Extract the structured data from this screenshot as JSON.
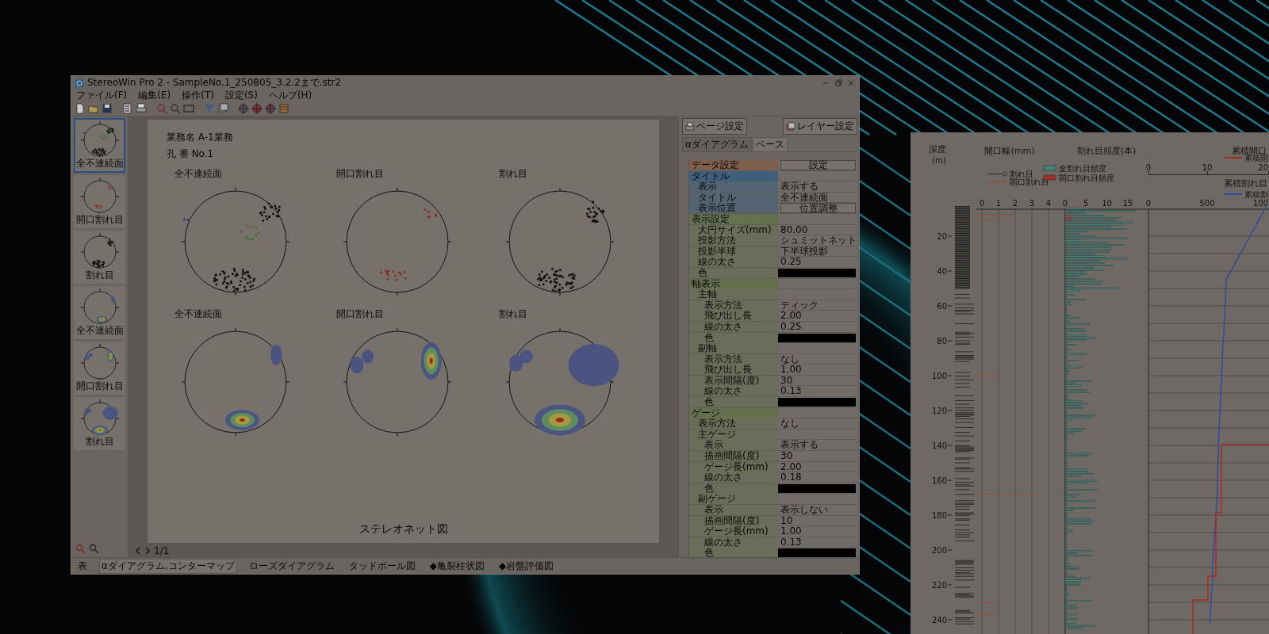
{
  "main_window": {
    "title": "StereoWin Pro 2 - SampleNo.1_250805_3.2.2まで.str2",
    "menu": [
      "ファイル(F)",
      "編集(E)",
      "操作(T)",
      "設定(S)",
      "ヘルプ(H)"
    ],
    "thumbnails": [
      {
        "label": "全不連続面",
        "kind": "points",
        "selected": true
      },
      {
        "label": "開口割れ目",
        "kind": "points",
        "selected": false
      },
      {
        "label": "割れ目",
        "kind": "points",
        "selected": false
      },
      {
        "label": "全不連続面",
        "kind": "contour",
        "selected": false
      },
      {
        "label": "開口割れ目",
        "kind": "contour",
        "selected": false
      },
      {
        "label": "割れ目",
        "kind": "contour",
        "selected": false
      }
    ],
    "document": {
      "project": "業務名 A-1業務",
      "hole": "孔 番 No.1",
      "caption": "ステレオネット図",
      "nets": [
        {
          "title": "全不連続面",
          "kind": "points"
        },
        {
          "title": "開口割れ目",
          "kind": "points"
        },
        {
          "title": "割れ目",
          "kind": "points"
        },
        {
          "title": "全不連続面",
          "kind": "contour"
        },
        {
          "title": "開口割れ目",
          "kind": "contour"
        },
        {
          "title": "割れ目",
          "kind": "contour"
        }
      ]
    },
    "page_indicator": "1/1",
    "panel": {
      "buttons": [
        "ページ設定",
        "レイヤー設定"
      ],
      "tabs": [
        {
          "label": "αダイアグラム",
          "selected": false
        },
        {
          "label": "ベース",
          "selected": true
        }
      ],
      "properties": [
        {
          "label": "データ設定",
          "kind": "button",
          "value": "設定",
          "color": "#7e5f4e"
        },
        {
          "label": "タイトル",
          "kind": "category",
          "color": "#3f5f7c",
          "children": [
            {
              "label": "表示",
              "kind": "text",
              "value": "表示する"
            },
            {
              "label": "タイトル",
              "kind": "text",
              "value": "全不連続面"
            },
            {
              "label": "表示位置",
              "kind": "button",
              "value": "位置調整"
            }
          ]
        },
        {
          "label": "表示設定",
          "kind": "category",
          "color": "#66704f",
          "children": [
            {
              "label": "大円サイズ(mm)",
              "kind": "text",
              "value": "80.00"
            },
            {
              "label": "投影方法",
              "kind": "text",
              "value": "シュミットネット"
            },
            {
              "label": "投影半球",
              "kind": "text",
              "value": "下半球投影"
            },
            {
              "label": "線の太さ",
              "kind": "text",
              "value": "0.25"
            },
            {
              "label": "色",
              "kind": "swatch",
              "color": "#000000"
            }
          ]
        },
        {
          "label": "軸表示",
          "kind": "category",
          "color": "#66704f",
          "children": [
            {
              "label": "主軸",
              "kind": "category",
              "children": [
                {
                  "label": "表示方法",
                  "kind": "text",
                  "value": "ティック"
                },
                {
                  "label": "飛び出し長",
                  "kind": "text",
                  "value": "2.00"
                },
                {
                  "label": "線の太さ",
                  "kind": "text",
                  "value": "0.25"
                },
                {
                  "label": "色",
                  "kind": "swatch",
                  "color": "#000000"
                }
              ]
            },
            {
              "label": "副軸",
              "kind": "category",
              "children": [
                {
                  "label": "表示方法",
                  "kind": "text",
                  "value": "なし"
                },
                {
                  "label": "飛び出し長",
                  "kind": "text",
                  "value": "1.00"
                },
                {
                  "label": "表示間隔(度)",
                  "kind": "text",
                  "value": "30"
                },
                {
                  "label": "線の太さ",
                  "kind": "text",
                  "value": "0.13"
                },
                {
                  "label": "色",
                  "kind": "swatch",
                  "color": "#000000"
                }
              ]
            }
          ]
        },
        {
          "label": "ゲージ",
          "kind": "category",
          "color": "#66704f",
          "children": [
            {
              "label": "表示方法",
              "kind": "text",
              "value": "なし"
            },
            {
              "label": "主ゲージ",
              "kind": "category",
              "children": [
                {
                  "label": "表示",
                  "kind": "text",
                  "value": "表示する"
                },
                {
                  "label": "描画間隔(度)",
                  "kind": "text",
                  "value": "30"
                },
                {
                  "label": "ゲージ長(mm)",
                  "kind": "text",
                  "value": "2.00"
                },
                {
                  "label": "線の太さ",
                  "kind": "text",
                  "value": "0.18"
                },
                {
                  "label": "色",
                  "kind": "swatch",
                  "color": "#000000"
                }
              ]
            },
            {
              "label": "副ゲージ",
              "kind": "category",
              "children": [
                {
                  "label": "表示",
                  "kind": "text",
                  "value": "表示しない"
                },
                {
                  "label": "描画間隔(度)",
                  "kind": "text",
                  "value": "10"
                },
                {
                  "label": "ゲージ長(mm)",
                  "kind": "text",
                  "value": "1.00"
                },
                {
                  "label": "線の太さ",
                  "kind": "text",
                  "value": "0.13"
                },
                {
                  "label": "色",
                  "kind": "swatch",
                  "color": "#000000"
                }
              ]
            }
          ]
        }
      ]
    },
    "bottom_tabs": [
      {
        "label": "表",
        "selected": false
      },
      {
        "label": "αダイアグラム,コンターマップ",
        "selected": true
      },
      {
        "label": "ローズダイアグラム",
        "selected": false
      },
      {
        "label": "タッドポール図",
        "selected": false
      },
      {
        "label": "◆亀裂柱状図",
        "selected": false
      },
      {
        "label": "◆岩盤評価図",
        "selected": false
      }
    ]
  },
  "depth_chart": {
    "depth_header": "深度",
    "depth_unit": "(m)",
    "aperture_header": "開口幅(mm)",
    "frequency_header": "割れ目頻度(本)",
    "cumulative_header": "累積開口",
    "cumulative_count_header": "累積割れ目",
    "aperture_legend": [
      {
        "label": "割れ目",
        "color": "#2e2e2e"
      },
      {
        "label": "開口割れ目",
        "color": "#9a4a3e"
      }
    ],
    "frequency_legend": [
      {
        "label": "全割れ目頻度",
        "color": "#3f857d"
      },
      {
        "label": "開口割れ目頻度",
        "color": "#a3302a"
      }
    ],
    "cumulative_legend": [
      {
        "label": "累積開",
        "color": "#a82a20"
      },
      {
        "label": "累積割",
        "color": "#2c4c9c"
      }
    ],
    "aperture_ticks": [
      "0",
      "1",
      "2",
      "3",
      "4"
    ],
    "frequency_ticks": [
      "0",
      "5",
      "10",
      "15"
    ],
    "cumulative_aperture_ticks": [
      "0",
      "10",
      "20"
    ],
    "cumulative_count_ticks": [
      "0",
      "500",
      "100"
    ],
    "depth_ticks": [
      "20",
      "40",
      "60",
      "80",
      "100",
      "120",
      "140",
      "160",
      "180",
      "200",
      "220",
      "240"
    ]
  }
}
